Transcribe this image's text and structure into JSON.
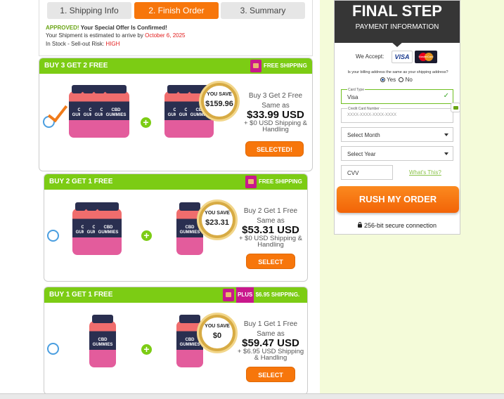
{
  "steps": [
    "1. Shipping Info",
    "2. Finish Order",
    "3. Summary"
  ],
  "info": {
    "approved": "APPROVED!",
    "approved_rest": "Your Special Offer Is Confirmed!",
    "arrival_text": "Your Shipment is estimated to arrive by",
    "arrival_date": "October 6, 2025",
    "stock_text": "In Stock - Sell-out Risk:",
    "stock_risk": "HIGH"
  },
  "packages": [
    {
      "header": "BUY 3 GET 2 FREE",
      "shipping_prefix": "",
      "shipping": "FREE SHIPPING",
      "you_save_label": "YOU SAVE",
      "you_save": "$159.96",
      "title": "Buy 3 Get 2 Free",
      "same_as": "Same as",
      "price": "$33.99 USD",
      "shipping_line1": "+ $0 USD Shipping &",
      "shipping_line2": "Handling",
      "button": "SELECTED!"
    },
    {
      "header": "BUY 2 GET 1 FREE",
      "shipping_prefix": "",
      "shipping": "FREE SHIPPING",
      "you_save_label": "YOU SAVE",
      "you_save": "$23.31",
      "title": "Buy 2 Get 1 Free",
      "same_as": "Same as",
      "price": "$53.31 USD",
      "shipping_line1": "+ $0 USD Shipping &",
      "shipping_line2": "Handling",
      "button": "SELECT"
    },
    {
      "header": "BUY 1 GET 1 FREE",
      "shipping_prefix": "PLUS",
      "shipping": "$6.95 SHIPPING.",
      "you_save_label": "YOU SAVE",
      "you_save": "$0",
      "title": "Buy 1 Get 1 Free",
      "same_as": "Same as",
      "price": "$59.47 USD",
      "shipping_line1": "+ $6.95 USD Shipping",
      "shipping_line2": "& Handling",
      "button": "SELECT"
    }
  ],
  "bottle_brand": "Pro Lifell",
  "bottle_label": "CBD\nGUMMIES",
  "panel": {
    "title": "FINAL STEP",
    "subtitle": "PAYMENT INFORMATION",
    "we_accept": "We Accept:",
    "visa": "VISA",
    "mastercard": "MasterCard",
    "billing_question": "Is your billing address the same as your shipping address?",
    "yes": "Yes",
    "no": "No",
    "card_type_label": "Card Type",
    "card_type_value": "Visa",
    "card_number_label": "Credit Card Number",
    "card_number_placeholder": "XXXX-XXXX-XXXX-XXXX",
    "month": "Select Month",
    "year": "Select Year",
    "cvv": "CVV",
    "whats_this": "What's This?",
    "rush": "RUSH MY ORDER",
    "secure": "256-bit secure connection"
  },
  "colors": {
    "accent_orange": "#f7760b",
    "header_green": "#7ccc14",
    "shipping_pink": "#c9188c",
    "approved_green": "#6aa515",
    "red_text": "#e21b1b",
    "radio_blue": "#4a9ee0"
  }
}
